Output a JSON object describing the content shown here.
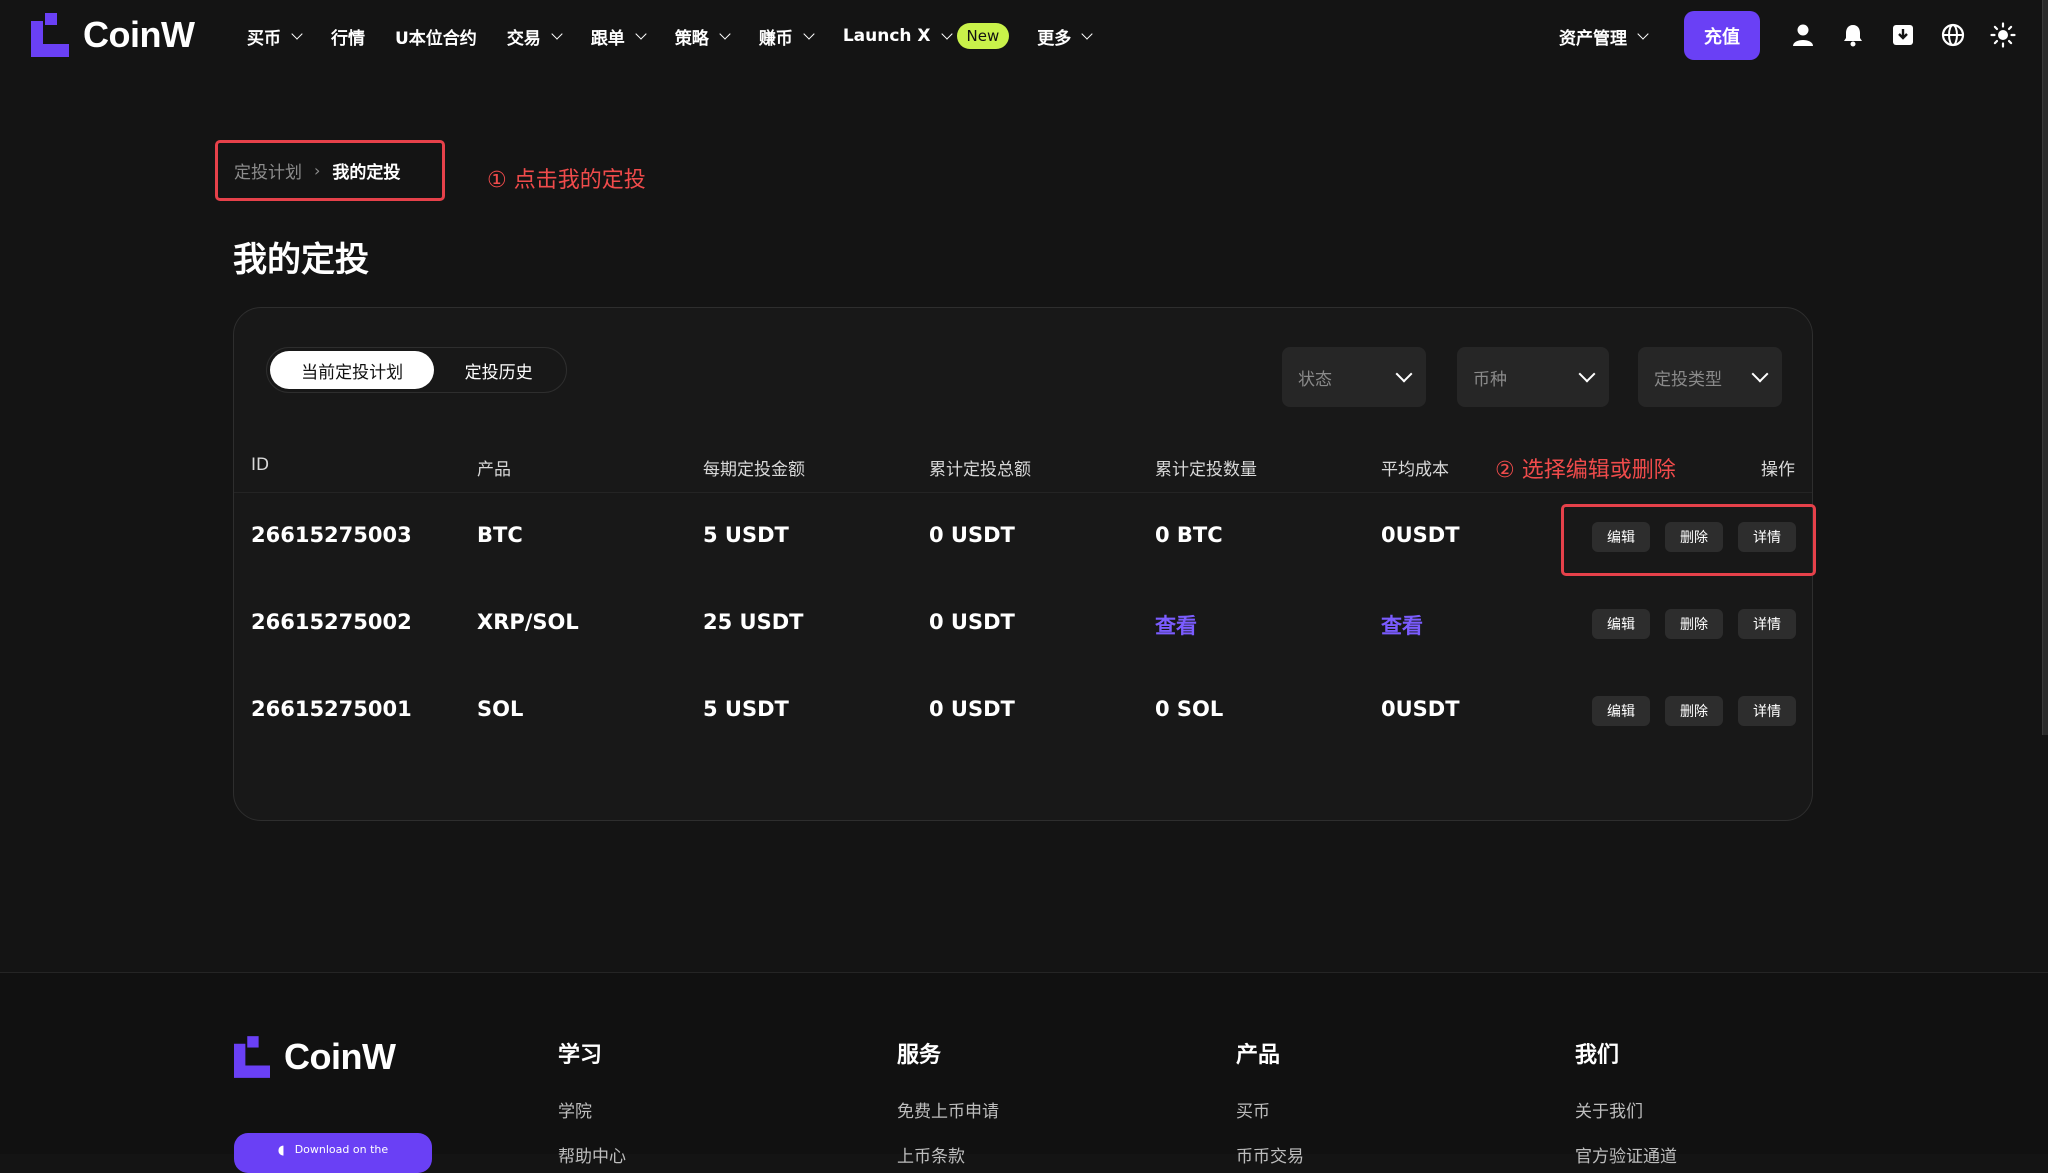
{
  "brand": {
    "name": "CoinW",
    "accent": "#6a40f5",
    "new_badge_color": "#c9f24a"
  },
  "nav": {
    "menu": [
      {
        "label": "买币",
        "dropdown": true
      },
      {
        "label": "行情",
        "dropdown": false
      },
      {
        "label": "U本位合约",
        "dropdown": false
      },
      {
        "label": "交易",
        "dropdown": true
      },
      {
        "label": "跟单",
        "dropdown": true
      },
      {
        "label": "策略",
        "dropdown": true
      },
      {
        "label": "赚币",
        "dropdown": true
      },
      {
        "label": "Launch X",
        "dropdown": true,
        "badge": "New"
      },
      {
        "label": "更多",
        "dropdown": true
      }
    ],
    "asset_label": "资产管理",
    "recharge_label": "充值",
    "icons": [
      "user-icon",
      "bell-icon",
      "download-icon",
      "globe-icon",
      "sun-icon"
    ]
  },
  "breadcrumb": {
    "parent": "定投计划",
    "current": "我的定投"
  },
  "annotations": {
    "step1": "① 点击我的定投",
    "step2": "② 选择编辑或删除"
  },
  "page_title": "我的定投",
  "tabs": [
    {
      "label": "当前定投计划",
      "active": true
    },
    {
      "label": "定投历史",
      "active": false
    }
  ],
  "filters": [
    {
      "placeholder": "状态"
    },
    {
      "placeholder": "币种"
    },
    {
      "placeholder": "定投类型"
    }
  ],
  "table": {
    "columns": [
      "ID",
      "产品",
      "每期定投金额",
      "累计定投总额",
      "累计定投数量",
      "平均成本",
      "操作"
    ],
    "rows": [
      {
        "id": "26615275003",
        "product": "BTC",
        "per_amount": "5 USDT",
        "total": "0 USDT",
        "quantity": "0 BTC",
        "avg_cost": "0USDT"
      },
      {
        "id": "26615275002",
        "product": "XRP/SOL",
        "per_amount": "25 USDT",
        "total": "0 USDT",
        "quantity": "查看",
        "avg_cost": "查看"
      },
      {
        "id": "26615275001",
        "product": "SOL",
        "per_amount": "5 USDT",
        "total": "0 USDT",
        "quantity": "0 SOL",
        "avg_cost": "0USDT"
      }
    ],
    "actions": {
      "edit": "编辑",
      "delete": "删除",
      "detail": "详情"
    }
  },
  "footer": {
    "columns": [
      {
        "title": "学习",
        "links": [
          "学院",
          "帮助中心"
        ]
      },
      {
        "title": "服务",
        "links": [
          "免费上币申请",
          "上币条款"
        ]
      },
      {
        "title": "产品",
        "links": [
          "买币",
          "币币交易"
        ]
      },
      {
        "title": "我们",
        "links": [
          "关于我们",
          "官方验证通道"
        ]
      }
    ],
    "download_label": "Download on the"
  }
}
